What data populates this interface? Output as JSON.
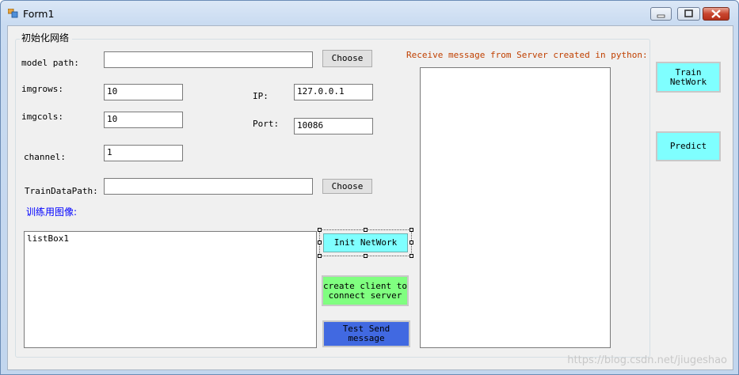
{
  "window": {
    "title": "Form1"
  },
  "groupbox": {
    "title": "初始化网络"
  },
  "fields": {
    "model_path": {
      "label": "model path:",
      "value": ""
    },
    "imgrows": {
      "label": "imgrows:",
      "value": "10"
    },
    "imgcols": {
      "label": "imgcols:",
      "value": "10"
    },
    "channel": {
      "label": "channel:",
      "value": "1"
    },
    "train_data_path": {
      "label": "TrainDataPath:",
      "value": ""
    },
    "ip": {
      "label": "IP:",
      "value": "127.0.0.1"
    },
    "port": {
      "label": "Port:",
      "value": "10086"
    }
  },
  "buttons": {
    "choose_model": "Choose",
    "choose_train": "Choose",
    "init_network": "Init NetWork",
    "create_client_line1": "create client to",
    "create_client_line2": "connect server",
    "test_send_line1": "Test Send",
    "test_send_line2": "message",
    "train_line1": "Train",
    "train_line2": "NetWork",
    "predict": "Predict"
  },
  "train_images_label": "训练用图像:",
  "listbox": {
    "items": [
      "listBox1"
    ]
  },
  "receive_label": "Receive message from Server created in python:",
  "receive_text": "",
  "watermark": "https://blog.csdn.net/jiugeshao",
  "colors": {
    "cyan_button": "#7fffff",
    "green_button": "#80ff80",
    "blue_button": "#4169e1",
    "blue_label": "#0000ff",
    "receive_label": "#c04000"
  }
}
